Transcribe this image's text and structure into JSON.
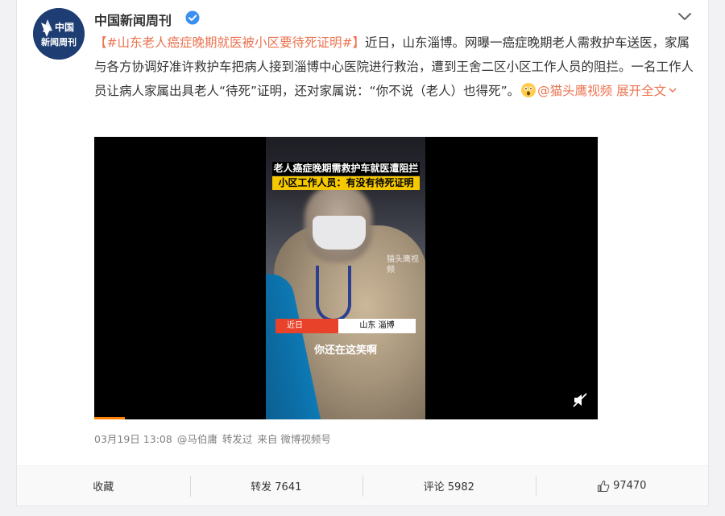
{
  "post": {
    "author": "中国新闻周刊",
    "avatar_text_line1": "中国",
    "avatar_text_line2": "新闻周刊",
    "hashtag": "【#山东老人癌症晚期就医被小区要待死证明#】",
    "body": "近日，山东淄博。网曝一癌症晚期老人需救护车送医，家属与各方协调好准许救护车把病人接到淄博中心医院进行救治，遭到王舍二区小区工作人员的阻拦。一名工作人员让病人家属出具老人“待死”证明，还对家属说：“你不说（老人）也得死”。",
    "mention": "@猫头鹰视频",
    "expand_label": "展开全文",
    "video": {
      "title_line1": "老人癌症晚期需救护车就医遭阻拦",
      "title_line2": "小区工作人员：有没有待死证明",
      "watermark": "猫头鹰视频",
      "location_left": "近日",
      "location_right": "山东 淄博",
      "subtitle": "你还在这笑啊",
      "progress_fraction": 0.06
    },
    "meta": {
      "timestamp": "03月19日 13:08",
      "forwarder": "@马伯庸",
      "forwarded_label": "转发过",
      "source": "来自 微博视频号"
    },
    "actions": {
      "favorite": "收藏",
      "repost": "转发 7641",
      "comment": "评论 5982",
      "like_count": "97470"
    }
  },
  "colors": {
    "accent": "#eb7350",
    "avatar_bg": "#1e3d73",
    "verified": "#f0b42a",
    "progress": "#ff8200"
  },
  "icons": [
    "chevron-down-icon",
    "verified-badge-icon",
    "astonished-emoji-icon",
    "mute-icon",
    "thumbs-up-icon"
  ]
}
